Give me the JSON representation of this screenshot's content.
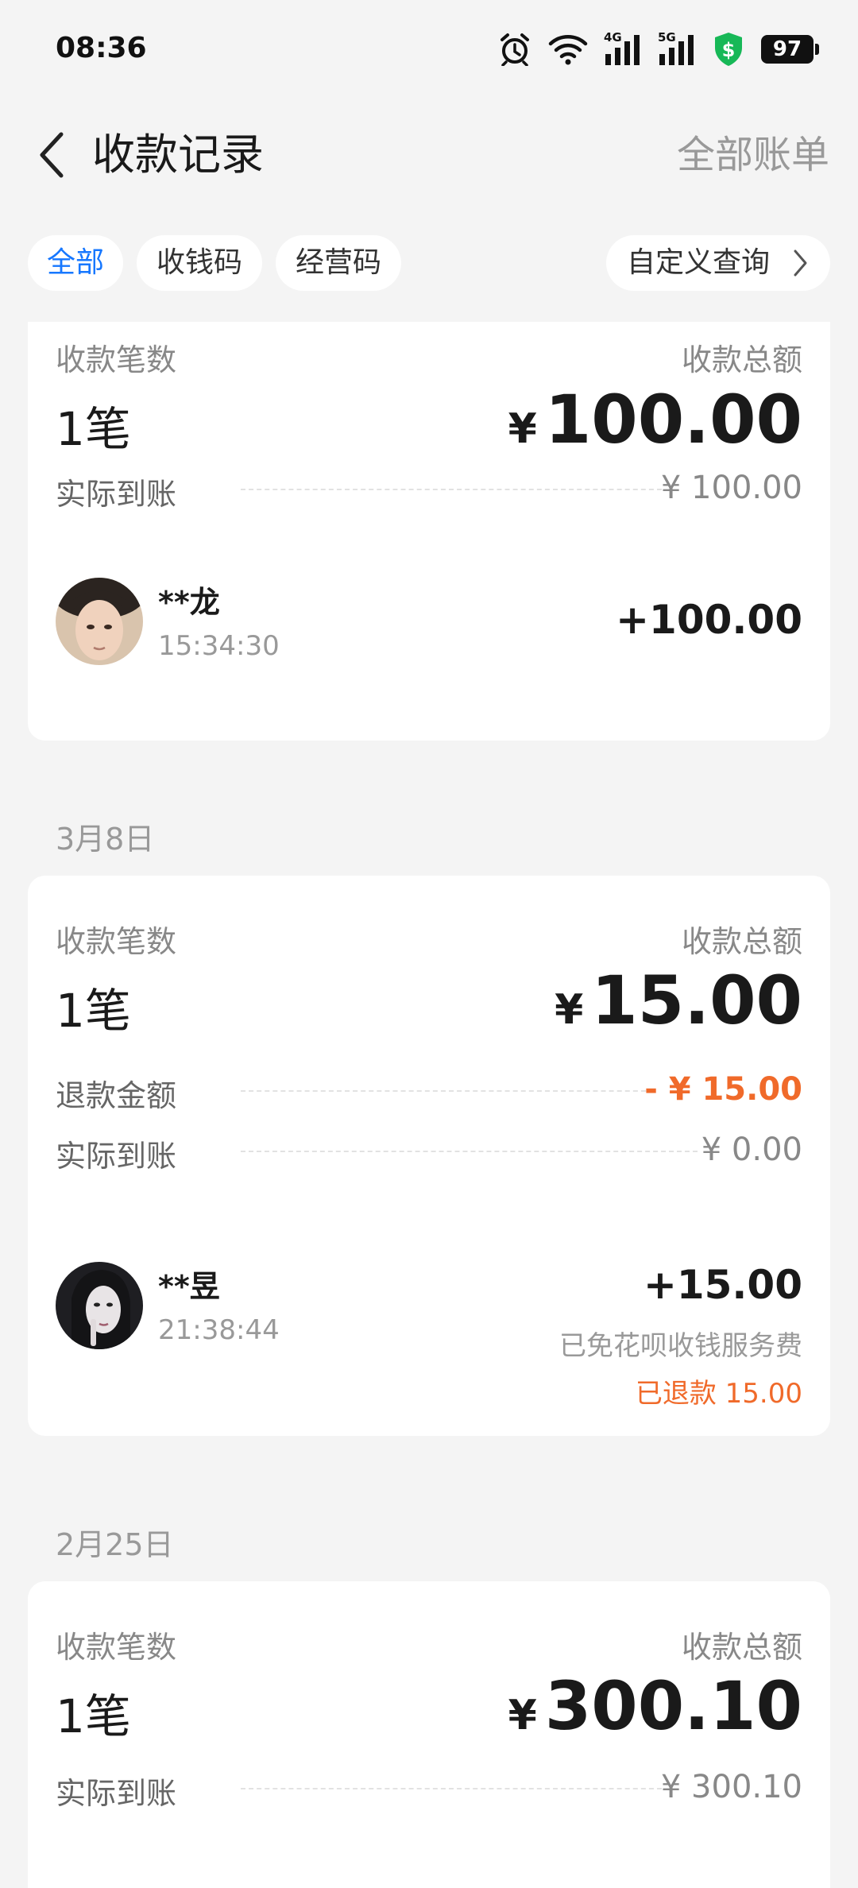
{
  "status_bar": {
    "time": "08:36",
    "net_4g": "4G",
    "net_5g": "5G",
    "battery": "97"
  },
  "nav": {
    "title": "收款记录",
    "right_link": "全部账单"
  },
  "filters": {
    "all": "全部",
    "qr_collect": "收钱码",
    "qr_business": "经营码",
    "custom_query": "自定义查询"
  },
  "groups": [
    {
      "count_label": "收款笔数",
      "count": "1笔",
      "total_label": "收款总额",
      "currency": "¥",
      "total": "100.00",
      "received_label": "实际到账",
      "received": "¥ 100.00",
      "tx": {
        "name": "**龙",
        "time": "15:34:30",
        "amount": "+100.00"
      }
    },
    {
      "date": "3月8日",
      "count_label": "收款笔数",
      "count": "1笔",
      "total_label": "收款总额",
      "currency": "¥",
      "total": "15.00",
      "refund_label": "退款金额",
      "refund": "- ¥ 15.00",
      "received_label": "实际到账",
      "received": "¥ 0.00",
      "tx": {
        "name": "**昱",
        "time": "21:38:44",
        "amount": "+15.00",
        "fee_note": "已免花呗收钱服务费",
        "refund_note": "已退款 15.00"
      }
    },
    {
      "date": "2月25日",
      "count_label": "收款笔数",
      "count": "1笔",
      "total_label": "收款总额",
      "currency": "¥",
      "total": "300.10",
      "received_label": "实际到账",
      "received": "¥ 300.10"
    }
  ],
  "colors": {
    "accent": "#1677ff",
    "refund": "#f06a2a",
    "muted": "#999999"
  }
}
